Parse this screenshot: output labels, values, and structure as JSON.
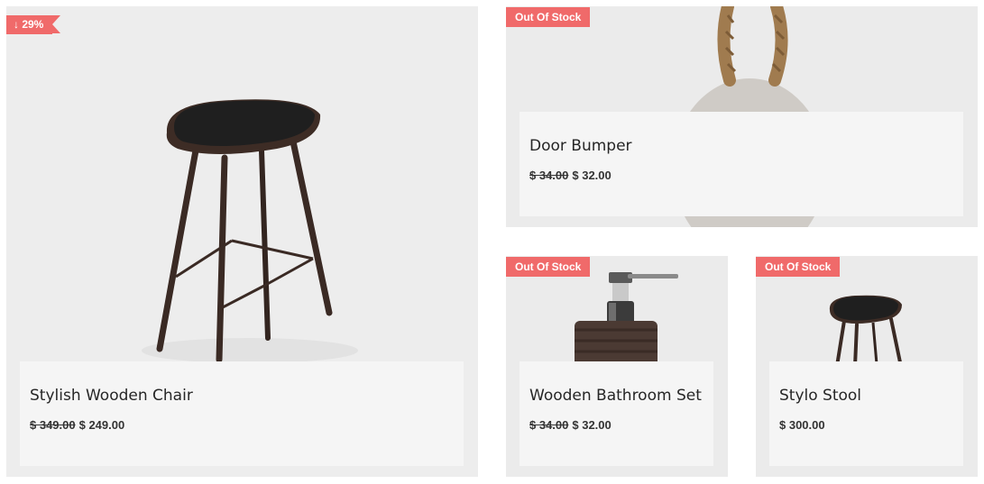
{
  "products": [
    {
      "title": "Stylish Wooden Chair",
      "old_price": "$ 349.00",
      "price": "$ 249.00",
      "badge": "↓ 29%",
      "image": "bar-stool-photo"
    },
    {
      "title": "Door Bumper",
      "old_price": "$ 34.00",
      "price": "$ 32.00",
      "badge": "Out Of Stock",
      "image": "rope-stone-door-bumper-photo"
    },
    {
      "title": "Wooden Bathroom Set",
      "old_price": "$ 34.00",
      "price": "$ 32.00",
      "badge": "Out Of Stock",
      "image": "soap-dispenser-photo"
    },
    {
      "title": "Stylo Stool",
      "price": "$ 300.00",
      "badge": "Out Of Stock",
      "image": "small-stool-photo"
    }
  ],
  "colors": {
    "badge": "#f06a6a",
    "card_background": "#ececec",
    "info_panel": "#f5f5f5",
    "text": "#262626"
  }
}
